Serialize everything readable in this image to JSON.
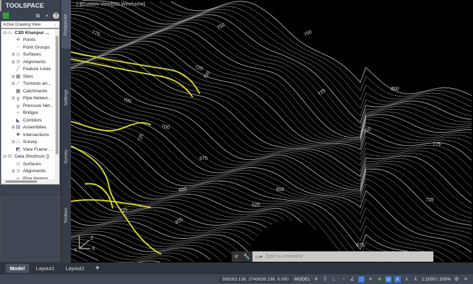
{
  "toolspace": {
    "title": "TOOLSPACE",
    "view_dropdown": "Active Drawing View",
    "tree": [
      {
        "label": "C3D Khanpur ...",
        "level": 0,
        "expand": "⊟",
        "icon": "drawing-icon",
        "bold": true
      },
      {
        "label": "Points",
        "level": 1,
        "expand": "",
        "icon": "points-icon"
      },
      {
        "label": "Point Groups",
        "level": 1,
        "expand": "",
        "icon": "point-groups-icon"
      },
      {
        "label": "Surfaces",
        "level": 1,
        "expand": "⊞",
        "icon": "surfaces-icon"
      },
      {
        "label": "Alignments",
        "level": 1,
        "expand": "⊞",
        "icon": "alignments-icon"
      },
      {
        "label": "Feature Lines",
        "level": 1,
        "expand": "",
        "icon": "feature-lines-icon"
      },
      {
        "label": "Sites",
        "level": 1,
        "expand": "⊞",
        "icon": "sites-icon"
      },
      {
        "label": "Turnouts an...",
        "level": 1,
        "expand": "⊞",
        "icon": "turnouts-icon"
      },
      {
        "label": "Catchments",
        "level": 1,
        "expand": "",
        "icon": "catchments-icon"
      },
      {
        "label": "Pipe Networ...",
        "level": 1,
        "expand": "⊞",
        "icon": "pipe-network-icon"
      },
      {
        "label": "Pressure Net...",
        "level": 1,
        "expand": "",
        "icon": "pressure-network-icon"
      },
      {
        "label": "Bridges",
        "level": 1,
        "expand": "",
        "icon": "bridges-icon"
      },
      {
        "label": "Corridors",
        "level": 1,
        "expand": "",
        "icon": "corridors-icon"
      },
      {
        "label": "Assemblies",
        "level": 1,
        "expand": "⊞",
        "icon": "assemblies-icon"
      },
      {
        "label": "Intersections",
        "level": 1,
        "expand": "",
        "icon": "intersections-icon"
      },
      {
        "label": "Survey",
        "level": 1,
        "expand": "⊞",
        "icon": "survey-icon"
      },
      {
        "label": "View Frame ...",
        "level": 1,
        "expand": "",
        "icon": "view-frame-icon"
      },
      {
        "label": "Data Shortcuts []",
        "level": 0,
        "expand": "⊟",
        "icon": "data-shortcuts-icon"
      },
      {
        "label": "Surfaces",
        "level": 1,
        "expand": "",
        "icon": "surfaces-icon"
      },
      {
        "label": "Alignments",
        "level": 1,
        "expand": "⊞",
        "icon": "alignments-icon"
      },
      {
        "label": "Pipe Networ...",
        "level": 1,
        "expand": "",
        "icon": "pipe-network-icon"
      }
    ]
  },
  "vertical_tabs": [
    "Prospector",
    "Settings",
    "Survey",
    "Toolbox"
  ],
  "viewport": {
    "label": "[-][Custom View][2D Wireframe]",
    "contour_labels": [
      "775",
      "725",
      "750",
      "700",
      "725",
      "800",
      "750",
      "700",
      "725",
      "675",
      "650",
      "625",
      "825",
      "775",
      "725",
      "675",
      "700",
      "650",
      "725",
      "750"
    ],
    "contour_color": "#d8d8d8",
    "alignment_color": "#d4d42a"
  },
  "command": {
    "placeholder": "Type a command"
  },
  "layout_tabs": [
    "Model",
    "Layout1",
    "Layout2",
    "+"
  ],
  "status": {
    "coords": "308263.139, 3745639.238, 0.000",
    "space": "MODEL",
    "scale": "1:1000 / 100%"
  }
}
